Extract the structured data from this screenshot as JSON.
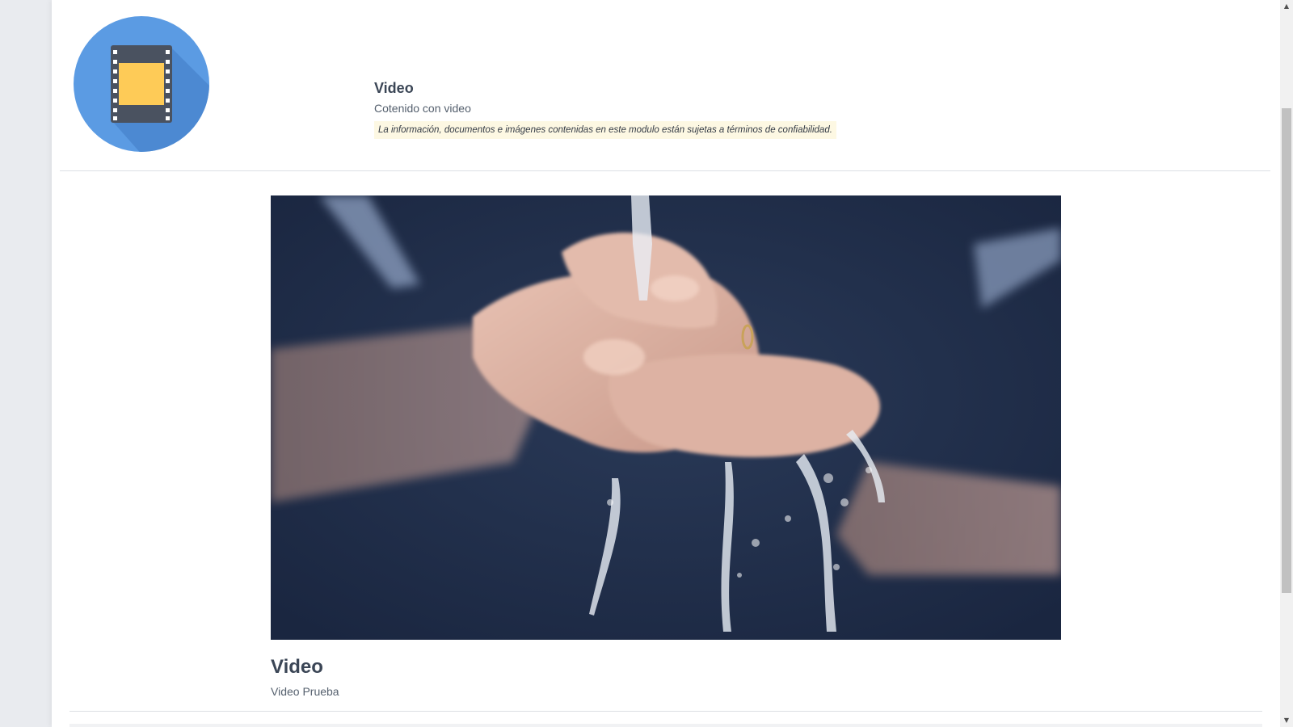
{
  "module": {
    "icon": "film-strip-icon",
    "title": "Video",
    "subtitle": "Cotenido con video",
    "notice": "La información, documentos e imágenes contenidas en este modulo están sujetas a términos de confiabilidad."
  },
  "video": {
    "thumbnail": "hand-washing-video-frame",
    "title": "Video",
    "caption": "Video Prueba"
  },
  "colors": {
    "icon_circle": "#5b9be3",
    "icon_shadow": "#4a86cf",
    "film_frame": "#4a5260",
    "film_center": "#fecb57",
    "notice_bg": "#fdf8e3",
    "text_dark": "#3b4656"
  }
}
